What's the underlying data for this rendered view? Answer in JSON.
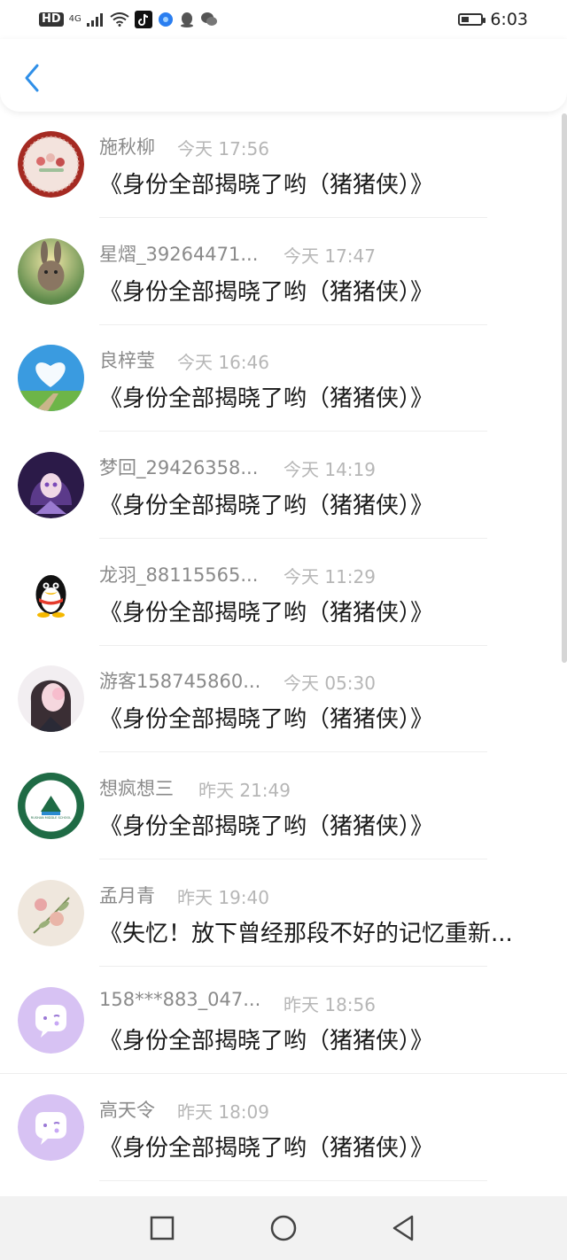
{
  "status_bar": {
    "network": "HD",
    "signal": "4G",
    "time": "6:03"
  },
  "header": {
    "back_icon": "chevron-left-icon",
    "accent_color": "#2f8fe8"
  },
  "messages": [
    {
      "name": "施秋柳",
      "time": "今天 17:56",
      "text": "《身份全部揭晓了哟（猪猪侠）》",
      "avatar": "cake-plate"
    },
    {
      "name": "星熠_39264471...",
      "time": "今天 17:47",
      "text": "《身份全部揭晓了哟（猪猪侠）》",
      "avatar": "rabbit"
    },
    {
      "name": "良梓莹",
      "time": "今天 16:46",
      "text": "《身份全部揭晓了哟（猪猪侠）》",
      "avatar": "heart-cloud-sky"
    },
    {
      "name": "梦回_29426358...",
      "time": "今天 14:19",
      "text": "《身份全部揭晓了哟（猪猪侠）》",
      "avatar": "anime-girl"
    },
    {
      "name": "龙羽_88115565...",
      "time": "今天 11:29",
      "text": "《身份全部揭晓了哟（猪猪侠）》",
      "avatar": "qq-penguin"
    },
    {
      "name": "游客158745860...",
      "time": "今天 05:30",
      "text": "《身份全部揭晓了哟（猪猪侠）》",
      "avatar": "girl-photo"
    },
    {
      "name": "想疯想三",
      "time": "昨天 21:49",
      "text": "《身份全部揭晓了哟（猪猪侠）》",
      "avatar": "school-emblem",
      "emblem_text": "RUSHAN MIDDLE SCHOOL"
    },
    {
      "name": "孟月青",
      "time": "昨天 19:40",
      "text": "《失忆！放下曾经那段不好的记忆重新...",
      "avatar": "flowers"
    },
    {
      "name": "158***883_047...",
      "time": "昨天 18:56",
      "text": "《身份全部揭晓了哟（猪猪侠）》",
      "avatar": "default-chat"
    },
    {
      "name": "高天令",
      "time": "昨天 18:09",
      "text": "《身份全部揭晓了哟（猪猪侠）》",
      "avatar": "default-chat"
    }
  ],
  "nav": {
    "recents_icon": "square-icon",
    "home_icon": "circle-icon",
    "back_icon": "triangle-back-icon"
  }
}
